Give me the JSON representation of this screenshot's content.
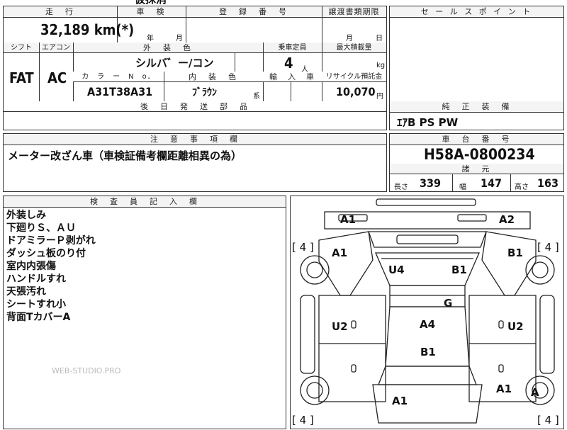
{
  "top_cut_text": "仮抹消",
  "vehicle": {
    "mileage_header": "走　行",
    "mileage": "32,189 km(*)",
    "inspection_header": "車　検",
    "year_unit": "年",
    "month_unit": "月",
    "registration_header": "登　録　番　号",
    "transfer_header": "譲渡書類期限",
    "transfer_month": "月",
    "transfer_day": "日",
    "shift_header": "シフト",
    "aircon_header": "エアコン",
    "exterior_color_header": "外　装　色",
    "capacity_header": "乗車定員",
    "max_load_header": "最大積載量",
    "shift": "FAT",
    "aircon": "AC",
    "exterior_color": "シルバ゛ー/コン",
    "capacity": "4",
    "capacity_unit": "人",
    "max_load_unit": "kg",
    "color_no_header": "カ　ラ　ー　N　o．",
    "interior_color_header": "内　装　色",
    "import_header": "輸　入　車",
    "recycle_header": "リサイクル預託金",
    "color_no": "A31T38A31",
    "interior_color": "ﾌﾞﾗｳﾝ",
    "interior_suffix": "系",
    "recycle_fee": "10,070",
    "recycle_unit": "円",
    "parts_header": "後　日　発　送　部　品"
  },
  "sales_points_header": "セ ー ル ス ポ イ ン ト",
  "equipment_header": "純　正　装　備",
  "equipment": "ｴｱB PS PW",
  "notes_header": "注　意　事　項　欄",
  "notes": "メーター改ざん車（車検証備考欄距離相異の為）",
  "chassis_header": "車　台　番　号",
  "chassis_number": "H58A-0800234",
  "dimensions_header": "諸　元",
  "dimensions": {
    "length_label": "長さ",
    "length": "339",
    "width_label": "幅",
    "width": "147",
    "height_label": "高さ",
    "height": "163"
  },
  "inspector_header": "検　査　員　記　入　欄",
  "inspector_notes": [
    "外装しみ",
    "下廻りＳ、ＡＵ",
    "ドアミラーＰ剥がれ",
    "ダッシュ板のり付",
    "室内内張傷",
    "ハンドルすれ",
    "天張汚れ",
    "シートすれ小",
    "背面TカバーA"
  ],
  "watermark": "WEB-STUDIO.PRO",
  "diagram": {
    "tire_marks": [
      "[ 4 ]",
      "[ 4 ]",
      "[ 4 ]",
      "[ 4 ]"
    ],
    "labels": [
      "A1",
      "A2",
      "A1",
      "B1",
      "U4",
      "B1",
      "G",
      "U2",
      "A4",
      "U2",
      "B1",
      "A1",
      "A",
      "A1"
    ]
  }
}
